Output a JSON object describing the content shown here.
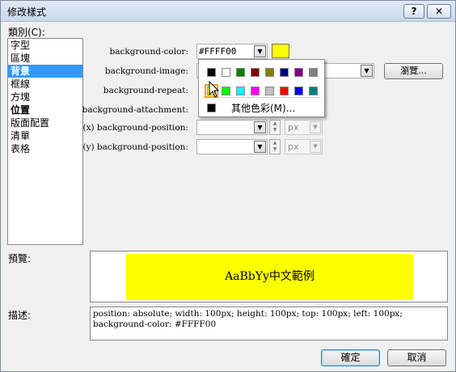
{
  "window": {
    "title": "修改樣式",
    "help_label": "?",
    "close_label": "✕"
  },
  "category": {
    "label": "類別(C):",
    "items": [
      "字型",
      "區塊",
      "背景",
      "框線",
      "方塊",
      "位置",
      "版面配置",
      "清單",
      "表格"
    ],
    "selected": "背景"
  },
  "props": {
    "bg_color_label": "background-color:",
    "bg_color_value": "#FFFF00",
    "bg_image_label": "background-image:",
    "bg_repeat_label": "background-repeat:",
    "bg_attachment_label": "background-attachment:",
    "x_pos_label": "(x) background-position:",
    "y_pos_label": "(y) background-position:",
    "unit_x": "px",
    "unit_y": "px",
    "browse_label": "瀏覽..."
  },
  "palette": {
    "row1": [
      "#000000",
      "#ffffff",
      "#008000",
      "#800000",
      "#808000",
      "#000080",
      "#800080",
      "#808080"
    ],
    "row2": [
      "#ffff00",
      "#00ff00",
      "#00ffff",
      "#ff00ff",
      "#c0c0c0",
      "#ff0000",
      "#0000ff",
      "#008080"
    ],
    "selected_color": "#ffff00",
    "other_colors_label": "其他色彩(M)..."
  },
  "preview": {
    "label": "預覽:",
    "sample_text": "AaBbYy中文範例",
    "bg_color": "#ffff00"
  },
  "description": {
    "label": "描述:",
    "text": "position: absolute; width: 100px; height: 100px; top: 100px; left: 100px; background-color: #FFFF00"
  },
  "buttons": {
    "ok": "確定",
    "cancel": "取消"
  }
}
